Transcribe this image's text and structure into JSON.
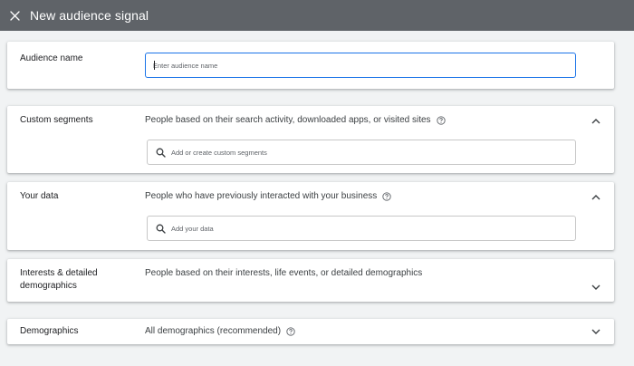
{
  "header": {
    "title": "New audience signal",
    "close_icon": "close-icon"
  },
  "audience_name": {
    "label": "Audience name",
    "input_value": "",
    "input_placeholder": "Enter audience name"
  },
  "custom_segments": {
    "label": "Custom segments",
    "description": "People based on their search activity, downloaded apps, or visited sites",
    "search_placeholder": "Add or create custom segments",
    "expanded": true
  },
  "your_data": {
    "label": "Your data",
    "description": "People who have previously interacted with your business",
    "search_placeholder": "Add your data",
    "expanded": true
  },
  "interests": {
    "label_line1": "Interests & detailed",
    "label_line2": "demographics",
    "description": "People based on their interests, life events, or detailed demographics",
    "expanded": false
  },
  "demographics": {
    "label": "Demographics",
    "description": "All demographics (recommended)",
    "expanded": false
  },
  "colors": {
    "topbar": "#5f6368",
    "focus_border": "#1a73e8",
    "background": "#f1f3f4"
  }
}
